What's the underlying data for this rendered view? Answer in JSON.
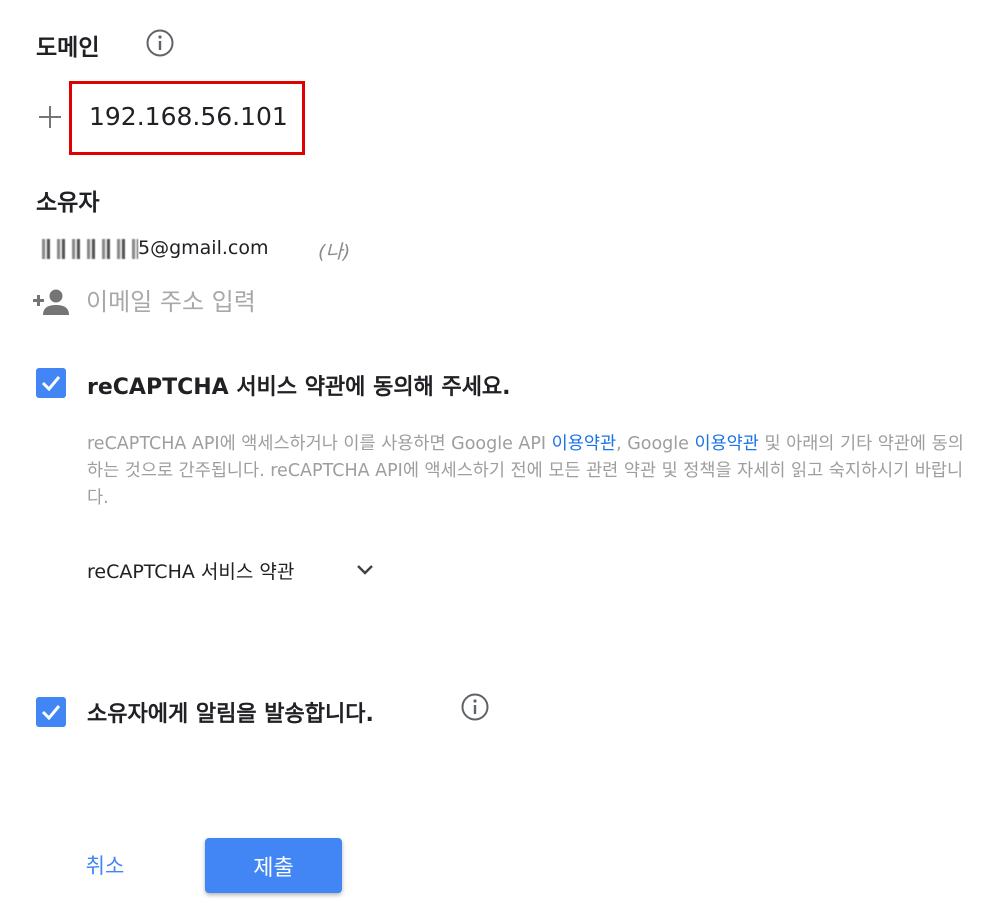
{
  "domain": {
    "title": "도메인",
    "info_icon": "info-icon",
    "add_icon": "plus-icon",
    "value": "192.168.56.101",
    "highlight_color": "#e00000"
  },
  "owners": {
    "title": "소유자",
    "email_suffix": "5@gmail.com",
    "me_label": "(나)",
    "add_person_icon": "person-add-icon",
    "email_placeholder": "이메일 주소 입력"
  },
  "recaptcha_terms": {
    "checked": true,
    "label": "reCAPTCHA 서비스 약관에 동의해 주세요.",
    "desc_part1": "reCAPTCHA API에 액세스하거나 이를 사용하면 Google API ",
    "link1": "이용약관",
    "desc_part2": ", Google ",
    "link2": "이용약관",
    "desc_part3": " 및 아래의 기타 약관에 동의하는 것으로 간주됩니다. reCAPTCHA API에 액세스하기 전에 모든 관련 약관 및 정책을 자세히 읽고 숙지하시기 바랍니다.",
    "toggle_label": "reCAPTCHA 서비스 약관",
    "toggle_icon": "chevron-down-icon"
  },
  "notify": {
    "checked": true,
    "label": "소유자에게 알림을 발송합니다.",
    "info_icon": "info-icon"
  },
  "actions": {
    "cancel_label": "취소",
    "submit_label": "제출"
  },
  "colors": {
    "accent": "#4285f4",
    "link": "#1a73e8"
  }
}
